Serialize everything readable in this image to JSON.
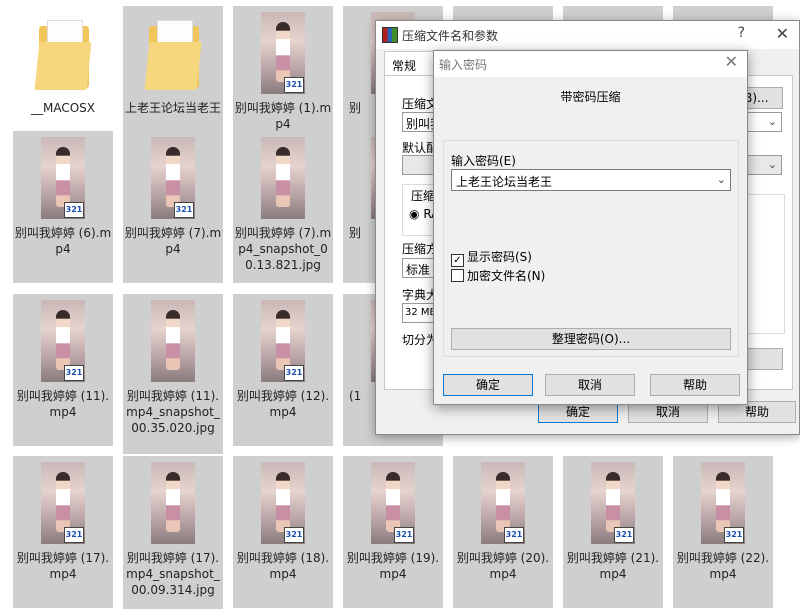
{
  "explorer": {
    "items": [
      {
        "name": "__MACOSX",
        "type": "folder"
      },
      {
        "name": "上老王论坛当老王",
        "type": "folder"
      },
      {
        "name": "别叫我婷婷 (1).mp4",
        "type": "video"
      },
      {
        "name": "别叫我婷婷 (6).mp4",
        "type": "video"
      },
      {
        "name": "别叫我婷婷 (7).mp4",
        "type": "video"
      },
      {
        "name": "别叫我婷婷 (7).mp4_snapshot_00.13.821.jpg",
        "type": "image"
      },
      {
        "name": "别叫我婷婷 (11).mp4",
        "type": "video"
      },
      {
        "name": "别叫我婷婷 (11).mp4_snapshot_00.35.020.jpg",
        "type": "image"
      },
      {
        "name": "别叫我婷婷 (12).mp4",
        "type": "video"
      },
      {
        "name": "别叫我婷婷 (17).mp4",
        "type": "video"
      },
      {
        "name": "别叫我婷婷 (17).mp4_snapshot_00.09.314.jpg",
        "type": "image"
      },
      {
        "name": "别叫我婷婷 (18).mp4",
        "type": "video"
      },
      {
        "name": "别叫我婷婷 (19).mp4",
        "type": "video"
      },
      {
        "name": "别叫我婷婷 (20).mp4",
        "type": "video"
      },
      {
        "name": "别叫我婷婷 (21).mp4",
        "type": "video"
      },
      {
        "name": "别叫我婷婷 (22).mp4",
        "type": "video"
      }
    ],
    "partial_labels": [
      "别",
      "别",
      "别",
      "(1",
      "(1"
    ],
    "badge_text": "321"
  },
  "archive_dialog": {
    "title": "压缩文件名和参数",
    "help": "?",
    "close": "✕",
    "tab_general": "常规",
    "archive_name_label": "压缩文",
    "archive_name_value": "别叫我",
    "browse_button": "(B)...",
    "default_profile_label": "默认配",
    "format_label": "压缩",
    "format_option": "RA",
    "method_label": "压缩方",
    "method_value": "标准",
    "dict_label": "字典大",
    "dict_value": "32 MB",
    "split_label": "切分为",
    "ok": "确定",
    "cancel": "取消",
    "help_button": "帮助"
  },
  "password_dialog": {
    "title": "输入密码",
    "close": "✕",
    "heading": "带密码压缩",
    "password_label": "输入密码(E)",
    "password_value": "上老王论坛当老王",
    "show_password": {
      "label": "显示密码(S)",
      "checked": true
    },
    "encrypt_filenames": {
      "label": "加密文件名(N)",
      "checked": false
    },
    "organize_button": "整理密码(O)...",
    "ok": "确定",
    "cancel": "取消",
    "help": "帮助"
  },
  "colors": {
    "tile_selected": "#cfcfcf",
    "dialog_bg": "#f0f0f0",
    "accent_border": "#0078d7"
  }
}
